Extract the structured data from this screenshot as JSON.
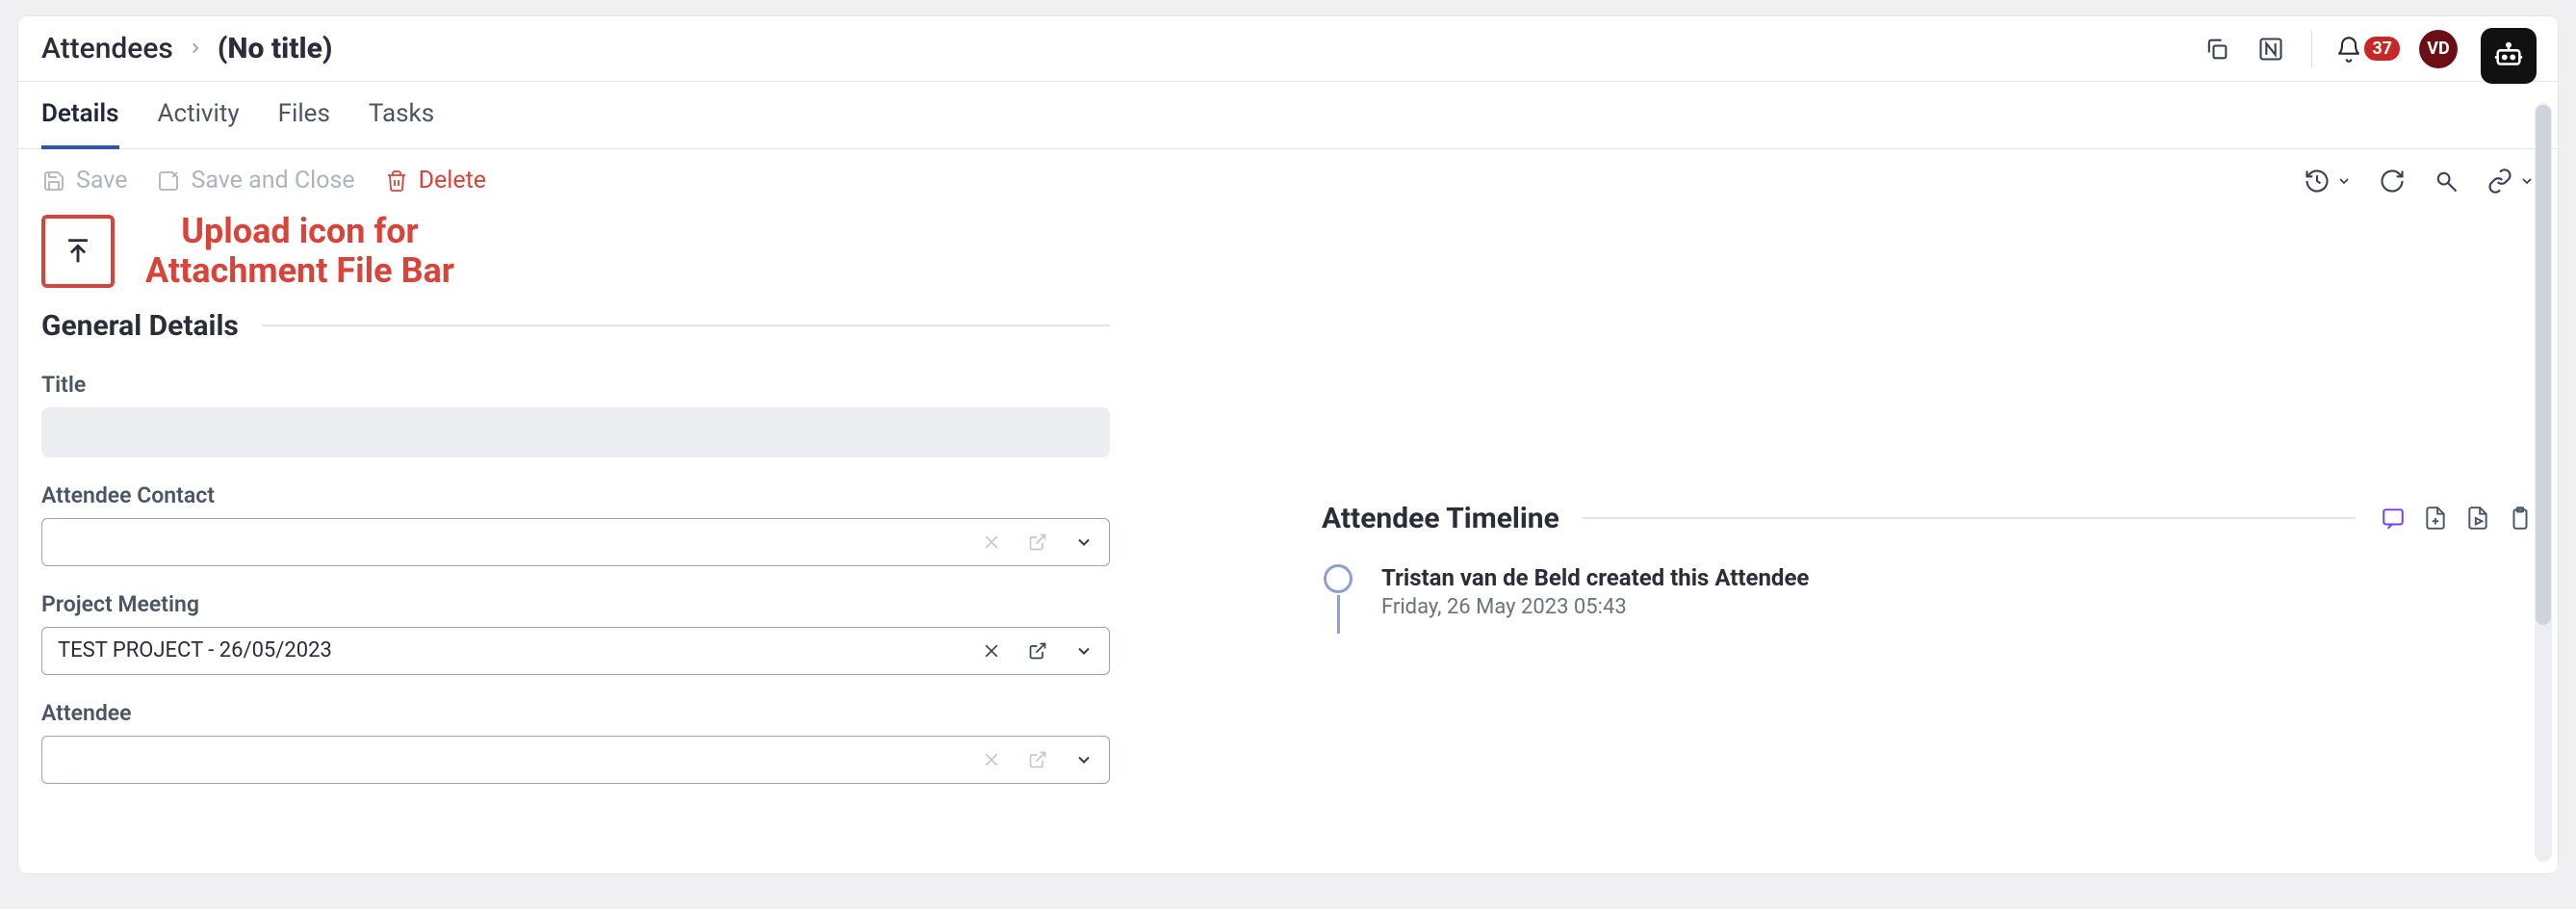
{
  "header": {
    "breadcrumb_parent": "Attendees",
    "breadcrumb_current": "(No title)",
    "notif_count": "37",
    "avatar_initials": "VD"
  },
  "tabs": [
    {
      "label": "Details",
      "active": true
    },
    {
      "label": "Activity",
      "active": false
    },
    {
      "label": "Files",
      "active": false
    },
    {
      "label": "Tasks",
      "active": false
    }
  ],
  "toolbar": {
    "save": "Save",
    "save_close": "Save and Close",
    "delete": "Delete"
  },
  "upload_caption_line1": "Upload icon for",
  "upload_caption_line2": "Attachment File Bar",
  "sections": {
    "general": "General Details",
    "timeline": "Attendee Timeline"
  },
  "fields": {
    "title_label": "Title",
    "title_value": "",
    "contact_label": "Attendee Contact",
    "contact_value": "",
    "meeting_label": "Project Meeting",
    "meeting_value": "TEST PROJECT - 26/05/2023",
    "attendee_label": "Attendee",
    "attendee_value": ""
  },
  "timeline": [
    {
      "title": "Tristan van de Beld created this Attendee",
      "date": "Friday, 26 May 2023 05:43"
    }
  ]
}
